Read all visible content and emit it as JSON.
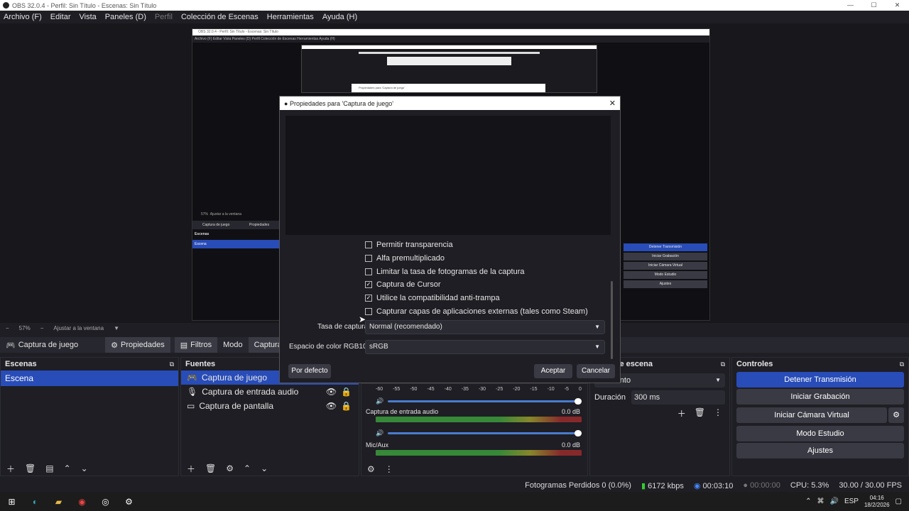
{
  "window": {
    "title": "OBS 32.0.4 - Perfil: Sin Título - Escenas: Sin Título",
    "minimize": "—",
    "maximize": "☐",
    "close": "✕"
  },
  "menu": {
    "archivo": "Archivo (F)",
    "editar": "Editar",
    "vista": "Vista",
    "paneles": "Paneles (D)",
    "perfil": "Perfil",
    "coleccion": "Colección de Escenas",
    "herramientas": "Herramientas",
    "ayuda": "Ayuda (H)"
  },
  "preview": {
    "zoom": "57%",
    "fit": "Ajustar a la ventana"
  },
  "source_toolbar": {
    "source_name": "Captura de juego",
    "properties": "Propiedades",
    "filters": "Filtros",
    "mode": "Modo",
    "mode_value": "Capturar cualqui"
  },
  "scenes": {
    "title": "Escenas",
    "items": [
      "Escena"
    ]
  },
  "sources": {
    "title": "Fuentes",
    "items": [
      "Captura de juego",
      "Captura de entrada audio",
      "Captura de pantalla"
    ]
  },
  "mixer": {
    "channels": [
      {
        "name": "Captura de entrada audio",
        "db": "0.0 dB"
      },
      {
        "name": "Mic/Aux",
        "db": "0.0 dB"
      }
    ],
    "ticks": [
      "-60",
      "-55",
      "-50",
      "-45",
      "-40",
      "-35",
      "-30",
      "-25",
      "-20",
      "-15",
      "-10",
      "-5",
      "0"
    ]
  },
  "transitions": {
    "title": "ones de escena",
    "value": "ecimiento",
    "duration_label": "Duración",
    "duration_value": "300 ms"
  },
  "controls": {
    "title": "Controles",
    "stop_stream": "Detener Transmisión",
    "start_record": "Iniciar Grabación",
    "start_vcam": "Iniciar Cámara Virtual",
    "studio_mode": "Modo Estudio",
    "settings": "Ajustes"
  },
  "status": {
    "dropped": "Fotogramas Perdidos 0 (0.0%)",
    "bitrate": "6172 kbps",
    "stream_time": "00:03:10",
    "rec_time": "00:00:00",
    "cpu": "CPU: 5.3%",
    "fps": "30.00 / 30.00 FPS"
  },
  "taskbar": {
    "lang": "ESP",
    "time": "04:16",
    "date": "18/2/2026"
  },
  "dialog": {
    "title": "Propiedades para 'Captura de juego'",
    "checkboxes": [
      {
        "label": "Permitir transparencia",
        "checked": false
      },
      {
        "label": "Alfa premultiplicado",
        "checked": false
      },
      {
        "label": "Limitar la tasa de fotogramas de la captura",
        "checked": false
      },
      {
        "label": "Captura de Cursor",
        "checked": true
      },
      {
        "label": "Utilice la compatibilidad anti-trampa",
        "checked": true
      },
      {
        "label": "Capturar capas de aplicaciones externas (tales como Steam)",
        "checked": false
      }
    ],
    "rate_label": "Tasa de captura",
    "rate_value": "Normal (recomendado)",
    "color_label": "Espacio de color RGB10A2",
    "color_value": "sRGB",
    "defaults": "Por defecto",
    "accept": "Aceptar",
    "cancel": "Cancelar",
    "check_mark": "✓"
  },
  "nested": {
    "title": "OBS 32.0.4 - Perfil: Sin Título - Escenas: Sin Título",
    "menu": "Archivo (F)   Editar   Vista   Paneles (D)   Perfil   Colección de Escenas   Herramientas   Ayuda (H)",
    "zoom": "57%",
    "fit": "Ajustar a la ventana",
    "source": "Captura de juego",
    "props": "Propiedades",
    "scenes": "Escenas",
    "scene": "Escena",
    "controls": [
      "Detener Transmisión",
      "Iniciar Grabación",
      "Iniciar Cámara Virtual",
      "Modo Estudio",
      "Ajustes"
    ],
    "inner_dialog": "Propiedades para 'Captura de juego'"
  }
}
